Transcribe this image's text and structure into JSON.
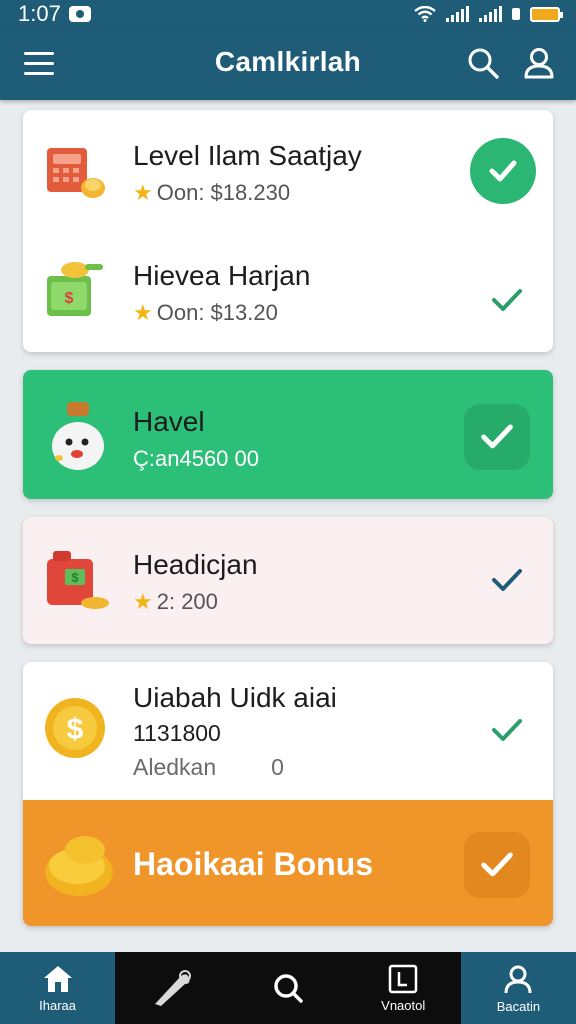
{
  "status_bar": {
    "time": "1:07"
  },
  "app_bar": {
    "title": "Camlkirlah"
  },
  "items": [
    {
      "name": "Level Ilam Saatjay",
      "detail": "Oon: $18.230",
      "icon": "cash-register-icon"
    },
    {
      "name": "Hievea Harjan",
      "detail": "Oon: $13.20",
      "icon": "money-stack-icon"
    },
    {
      "name": "Havel",
      "detail": "Ç:an4560 00",
      "icon": "money-bag-icon"
    },
    {
      "name": "Headicjan",
      "detail": "2: 200",
      "icon": "cash-register-icon"
    },
    {
      "name": "Uiabah Uidk aiai",
      "amount": "1131800",
      "note_label": "Aledkan",
      "note_value": "0",
      "icon": "gear-coin-icon"
    },
    {
      "name": "Haoikaai Bonus",
      "icon": "gold-coins-icon"
    }
  ],
  "tabs": [
    {
      "label": "Iharaa",
      "icon": "home-icon"
    },
    {
      "label": "",
      "icon": "horn-icon"
    },
    {
      "label": "",
      "icon": "search-icon"
    },
    {
      "label": "Vnaotol",
      "icon": "calendar-icon"
    },
    {
      "label": "Bacatin",
      "icon": "profile-icon"
    }
  ],
  "colors": {
    "primary": "#1f5c78",
    "green": "#2cbf77",
    "orange": "#f0952a",
    "pink": "#fbf0f1",
    "check_dark": "#1f5c78",
    "check_green": "#2c9e6b"
  }
}
